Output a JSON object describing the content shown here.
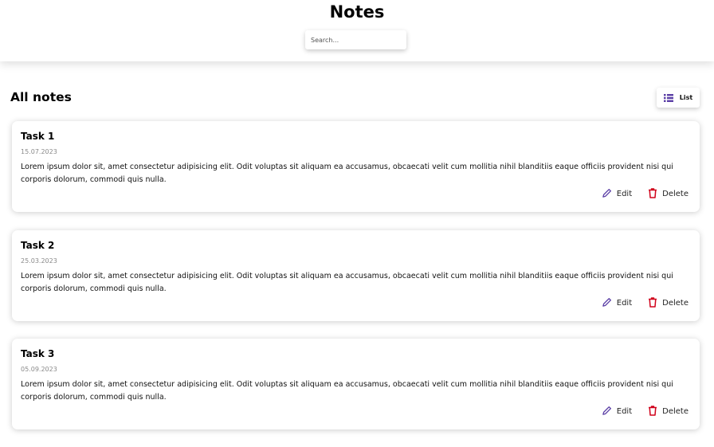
{
  "header": {
    "title": "Notes",
    "search": {
      "placeholder": "Search...",
      "value": ""
    }
  },
  "main": {
    "section_title": "All notes",
    "view_toggle": {
      "label": "List",
      "icon": "list-icon"
    },
    "notes": [
      {
        "title": "Task 1",
        "date": "15.07.2023",
        "body": "Lorem ipsum dolor sit, amet consectetur adipisicing elit. Odit voluptas sit aliquam ea accusamus, obcaecati velit cum mollitia nihil blanditiis eaque officiis provident nisi qui corporis dolorum, commodi quis nulla.",
        "edit_label": "Edit",
        "delete_label": "Delete"
      },
      {
        "title": "Task 2",
        "date": "25.03.2023",
        "body": "Lorem ipsum dolor sit, amet consectetur adipisicing elit. Odit voluptas sit aliquam ea accusamus, obcaecati velit cum mollitia nihil blanditiis eaque officiis provident nisi qui corporis dolorum, commodi quis nulla.",
        "edit_label": "Edit",
        "delete_label": "Delete"
      },
      {
        "title": "Task 3",
        "date": "05.09.2023",
        "body": "Lorem ipsum dolor sit, amet consectetur adipisicing elit. Odit voluptas sit aliquam ea accusamus, obcaecati velit cum mollitia nihil blanditiis eaque officiis provident nisi qui corporis dolorum, commodi quis nulla.",
        "edit_label": "Edit",
        "delete_label": "Delete"
      }
    ]
  },
  "colors": {
    "accent": "#5b3fa6",
    "delete": "#d0021b",
    "date": "#8a8a8a"
  }
}
